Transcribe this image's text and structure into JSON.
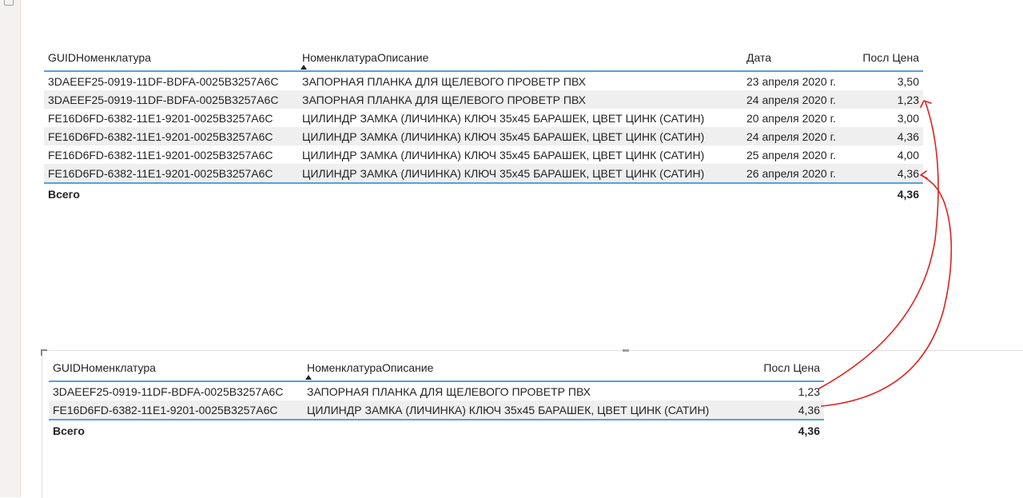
{
  "top_table": {
    "columns": [
      "GUIDНоменклатура",
      "НоменклатураОписание",
      "Дата",
      "Посл Цена"
    ],
    "rows": [
      {
        "guid": "3DAEEF25-0919-11DF-BDFA-0025B3257A6C",
        "desc": "ЗАПОРНАЯ ПЛАНКА ДЛЯ ЩЕЛЕВОГО ПРОВЕТР ПВХ",
        "date": "23 апреля 2020 г.",
        "price": "3,50"
      },
      {
        "guid": "3DAEEF25-0919-11DF-BDFA-0025B3257A6C",
        "desc": "ЗАПОРНАЯ ПЛАНКА ДЛЯ ЩЕЛЕВОГО ПРОВЕТР ПВХ",
        "date": "24 апреля 2020 г.",
        "price": "1,23"
      },
      {
        "guid": "FE16D6FD-6382-11E1-9201-0025B3257A6C",
        "desc": "ЦИЛИНДР ЗАМКА (ЛИЧИНКА) КЛЮЧ 35х45 БАРАШЕК, ЦВЕТ ЦИНК (САТИН)",
        "date": "20 апреля 2020 г.",
        "price": "3,00"
      },
      {
        "guid": "FE16D6FD-6382-11E1-9201-0025B3257A6C",
        "desc": "ЦИЛИНДР ЗАМКА (ЛИЧИНКА) КЛЮЧ 35х45 БАРАШЕК, ЦВЕТ ЦИНК (САТИН)",
        "date": "24 апреля 2020 г.",
        "price": "4,36"
      },
      {
        "guid": "FE16D6FD-6382-11E1-9201-0025B3257A6C",
        "desc": "ЦИЛИНДР ЗАМКА (ЛИЧИНКА) КЛЮЧ 35х45 БАРАШЕК, ЦВЕТ ЦИНК (САТИН)",
        "date": "25 апреля 2020 г.",
        "price": "4,00"
      },
      {
        "guid": "FE16D6FD-6382-11E1-9201-0025B3257A6C",
        "desc": "ЦИЛИНДР ЗАМКА (ЛИЧИНКА) КЛЮЧ 35х45 БАРАШЕК, ЦВЕТ ЦИНК (САТИН)",
        "date": "26 апреля 2020 г.",
        "price": "4,36"
      }
    ],
    "total_label": "Всего",
    "total_value": "4,36"
  },
  "bottom_table": {
    "columns": [
      "GUIDНоменклатура",
      "НоменклатураОписание",
      "Посл Цена"
    ],
    "rows": [
      {
        "guid": "3DAEEF25-0919-11DF-BDFA-0025B3257A6C",
        "desc": "ЗАПОРНАЯ ПЛАНКА ДЛЯ ЩЕЛЕВОГО ПРОВЕТР ПВХ",
        "price": "1,23"
      },
      {
        "guid": "FE16D6FD-6382-11E1-9201-0025B3257A6C",
        "desc": "ЦИЛИНДР ЗАМКА (ЛИЧИНКА) КЛЮЧ 35х45 БАРАШЕК, ЦВЕТ ЦИНК (САТИН)",
        "price": "4,36"
      }
    ],
    "total_label": "Всего",
    "total_value": "4,36"
  },
  "colors": {
    "header_underline": "#5aa0d8",
    "alt_row": "#efefef",
    "annotation": "#e02020"
  },
  "icons": {
    "sort_indicator": "sort-ascending-icon",
    "rail": "page-icon"
  }
}
